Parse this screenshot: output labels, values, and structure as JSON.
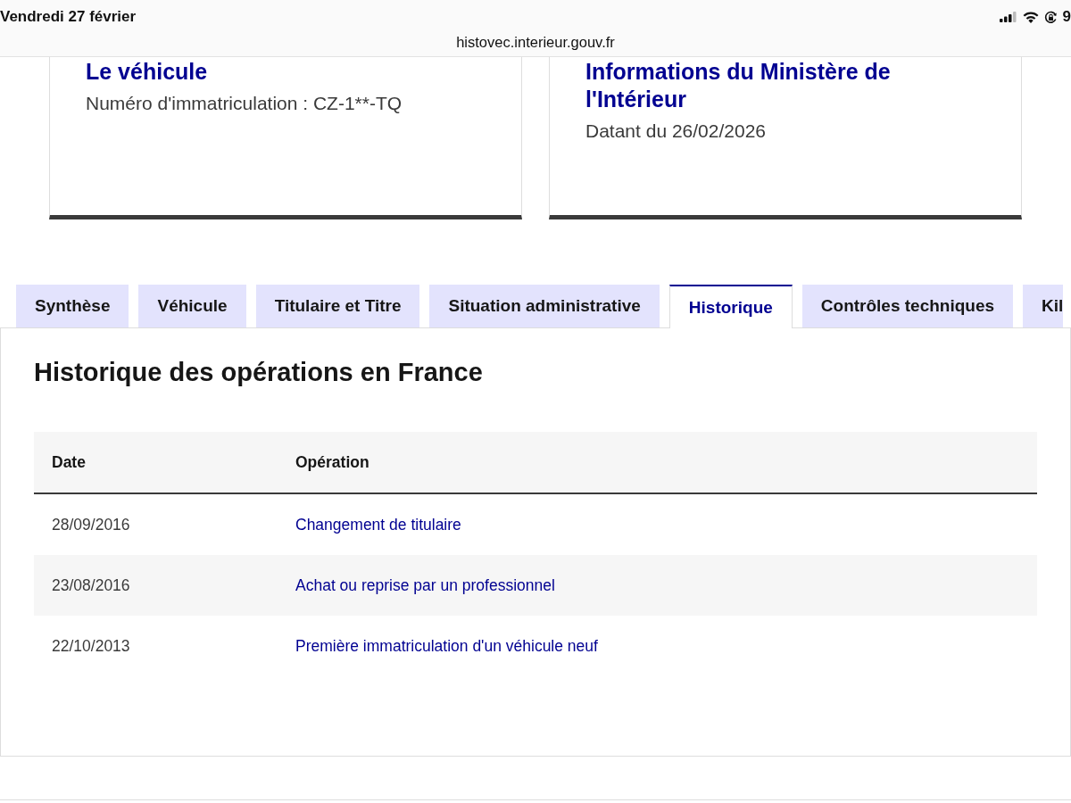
{
  "status_bar": {
    "date": "Vendredi 27 février",
    "battery": "9"
  },
  "address_bar": {
    "url": "histovec.interieur.gouv.fr"
  },
  "cards": [
    {
      "title": "Le véhicule",
      "text": "Numéro d'immatriculation : CZ-1**-TQ"
    },
    {
      "title": "Informations du Ministère de l'Intérieur",
      "text": "Datant du 26/02/2026"
    }
  ],
  "tabs": [
    {
      "label": "Synthèse",
      "selected": false
    },
    {
      "label": "Véhicule",
      "selected": false
    },
    {
      "label": "Titulaire et Titre",
      "selected": false
    },
    {
      "label": "Situation administrative",
      "selected": false
    },
    {
      "label": "Historique",
      "selected": true
    },
    {
      "label": "Contrôles techniques",
      "selected": false
    },
    {
      "label": "Kil",
      "selected": false
    }
  ],
  "panel": {
    "heading": "Historique des opérations en France",
    "table": {
      "columns": [
        "Date",
        "Opération"
      ],
      "rows": [
        {
          "date": "28/09/2016",
          "operation": "Changement de titulaire"
        },
        {
          "date": "23/08/2016",
          "operation": "Achat ou reprise par un professionnel"
        },
        {
          "date": "22/10/2013",
          "operation": "Première immatriculation d'un véhicule neuf"
        }
      ]
    }
  }
}
